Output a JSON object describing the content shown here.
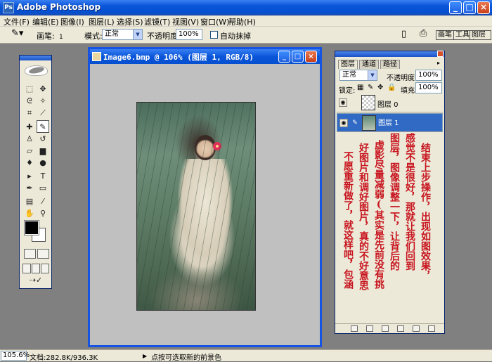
{
  "window": {
    "title": "Adobe Photoshop",
    "minimize": "_",
    "maximize": "□",
    "close": "×",
    "icon": "Ps"
  },
  "menu": [
    "文件(F)",
    "编辑(E)",
    "图像(I)",
    "图层(L)",
    "选择(S)",
    "滤镜(T)",
    "视图(V)",
    "窗口(W)",
    "帮助(H)"
  ],
  "options": {
    "brush_label": "画笔:",
    "brush_size": "1",
    "mode_label": "模式:",
    "mode_value": "正常",
    "opacity_label": "不透明度:",
    "opacity_value": "100%",
    "airbrush_label": "自动抹掉",
    "tabs": [
      "画笔",
      "工具",
      "图层复"
    ]
  },
  "document": {
    "title": "Image6.bmp @ 106% (图层 1, RGB/8)"
  },
  "layers_panel": {
    "tabs": [
      "图层",
      "通道",
      "路径"
    ],
    "blend_mode": "正常",
    "opacity_label": "不透明度:",
    "opacity_value": "100%",
    "lock_label": "锁定:",
    "fill_label": "填充:",
    "fill_value": "100%",
    "layers": [
      {
        "name": "图层 0",
        "selected": false
      },
      {
        "name": "图层 1",
        "selected": true
      }
    ],
    "note_columns": [
      "结束上步操作，出现如图效果，",
      "感觉不是很好，那就让我们回到",
      "图层，图像调整一下，让背后的",
      "虚影尽量减弱(其实是先前没有挑",
      "好图片和调好图片，真的不好意思",
      "不愿重新做了，就这样吧，包涵"
    ],
    "note_color": "#c8141e"
  },
  "status": {
    "zoom": "105.6%",
    "doc_info": "文档:282.8K/936.3K",
    "tip": "点按可选取新的前景色",
    "tip_marker": "▶"
  },
  "tools": {
    "icons": [
      "marquee-icon",
      "move-icon",
      "lasso-icon",
      "magic-wand-icon",
      "crop-icon",
      "slice-icon",
      "healing-icon",
      "brush-icon",
      "stamp-icon",
      "history-brush-icon",
      "eraser-icon",
      "gradient-icon",
      "blur-icon",
      "dodge-icon",
      "path-select-icon",
      "type-icon",
      "pen-icon",
      "shape-icon",
      "notes-icon",
      "eyedropper-icon",
      "hand-icon",
      "zoom-icon"
    ],
    "foreground_color": "#000000",
    "background_color": "#ffffff"
  }
}
